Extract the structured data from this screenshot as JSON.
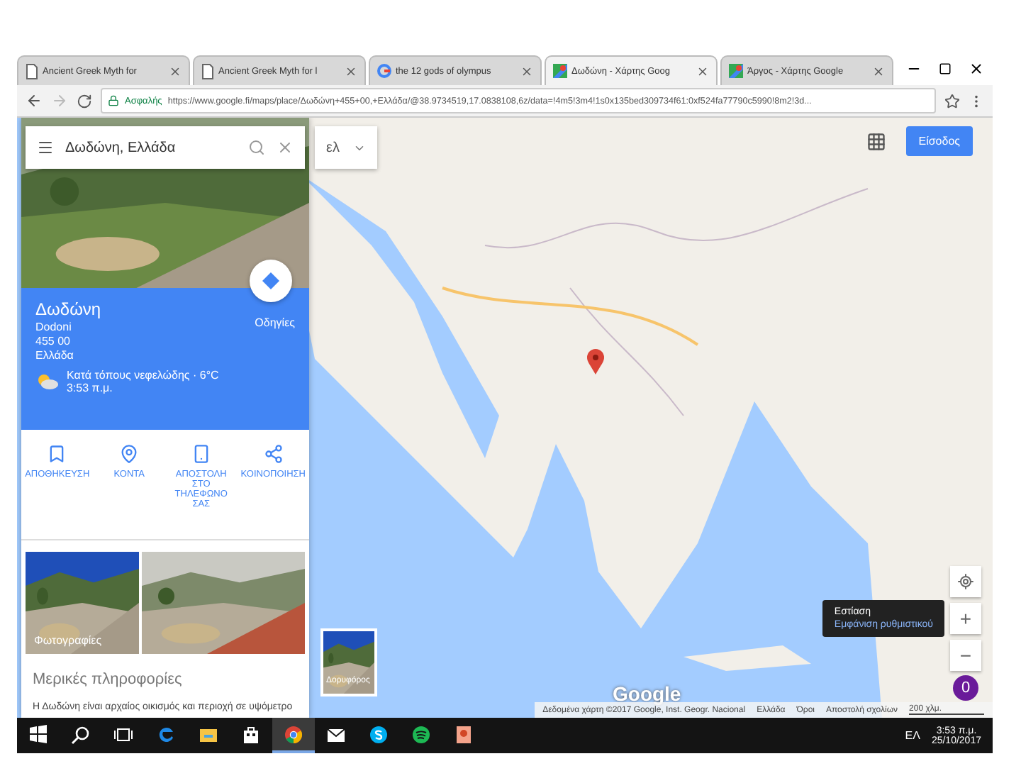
{
  "browser": {
    "tabs": [
      {
        "kind": "doc",
        "title": "Ancient Greek Myth for",
        "selected": false
      },
      {
        "kind": "doc",
        "title": "Ancient Greek Myth for l",
        "selected": false
      },
      {
        "kind": "google",
        "title": "the 12 gods of olympus",
        "selected": false
      },
      {
        "kind": "maps",
        "title": "Δωδώνη - Χάρτης Goog",
        "selected": true
      },
      {
        "kind": "maps",
        "title": "Άργος - Χάρτης Google",
        "selected": false
      }
    ],
    "address": {
      "secure_label": "Ασφαλής",
      "url": "https://www.google.fi/maps/place/Δωδώνη+455+00,+Ελλάδα/@38.9734519,17.0838108,6z/data=!4m5!3m4!1s0x135bed309734f61:0xf524fa77790c5990!8m2!3d..."
    }
  },
  "panel": {
    "search": {
      "value": "Δωδώνη, Ελλάδα"
    },
    "place": {
      "name": "Δωδώνη",
      "lines": [
        "Dodoni",
        "455 00",
        "Ελλάδα"
      ],
      "directions_label": "Οδηγίες",
      "weather": "Κατά τόπους νεφελώδης · 6°C",
      "time": "3:53 π.μ."
    },
    "actions": [
      {
        "kind": "save",
        "label": "ΑΠΟΘΗΚΕΥΣΗ"
      },
      {
        "kind": "nearby",
        "label": "ΚΟΝΤΑ"
      },
      {
        "kind": "phone",
        "label": "ΑΠΟΣΤΟΛΗ ΣΤΟ ΤΗΛΕΦΩΝΟ ΣΑΣ"
      },
      {
        "kind": "share",
        "label": "ΚΟΙΝΟΠΟΙΗΣΗ"
      }
    ],
    "photos_label": "Φωτογραφίες",
    "section_title": "Μερικές πληροφορίες",
    "description": "Η Δωδώνη είναι αρχαίος οικισμός και περιοχή σε υψόμετρο"
  },
  "map": {
    "language": "ελ",
    "sign_in": "Είσοδος",
    "tooltip": {
      "title": "Εστίαση",
      "subtitle": "Εμφάνιση ρυθμιστικού"
    },
    "zoom_in": "+",
    "zoom_out": "−",
    "satellite_label": "Δορυφόρος",
    "logo": "Google",
    "badge": "0",
    "attribution": [
      "Δεδομένα χάρτη ©2017 Google, Inst. Geogr. Nacional",
      "Ελλάδα",
      "Όροι",
      "Αποστολή σχολίων"
    ],
    "scale": "200 χλμ."
  },
  "taskbar": {
    "apps": [
      {
        "kind": "start",
        "selected": false
      },
      {
        "kind": "search",
        "selected": false
      },
      {
        "kind": "taskview",
        "selected": false
      },
      {
        "kind": "edge",
        "selected": false
      },
      {
        "kind": "explorer",
        "selected": false
      },
      {
        "kind": "store",
        "selected": false
      },
      {
        "kind": "chrome",
        "selected": true
      },
      {
        "kind": "mail",
        "selected": false
      },
      {
        "kind": "skype",
        "selected": false
      },
      {
        "kind": "spotify",
        "selected": false
      },
      {
        "kind": "powerpoint",
        "selected": false
      }
    ],
    "language": "ΕΛ",
    "time": "3:53 π.μ.",
    "date": "25/10/2017"
  }
}
